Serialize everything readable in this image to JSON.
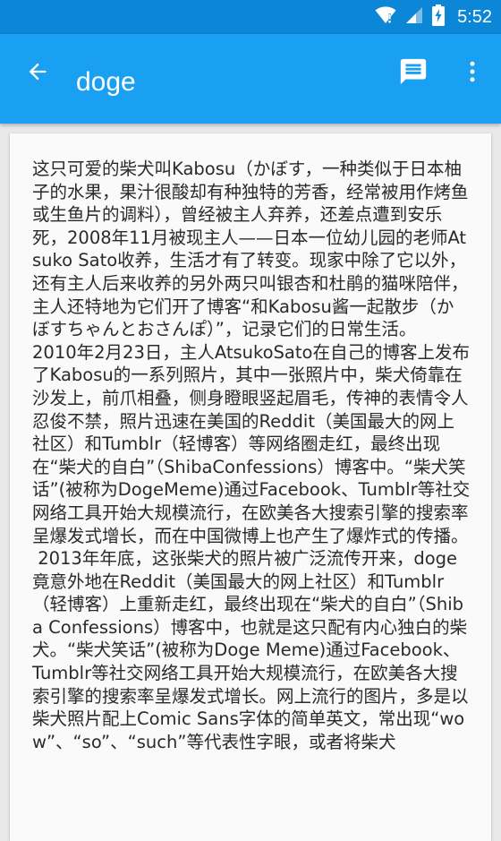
{
  "status_bar": {
    "time": "5:52",
    "icons": [
      "wifi-icon",
      "signal-icon",
      "battery-charging-icon"
    ]
  },
  "app_bar": {
    "title": "doge",
    "back_icon": "arrow-back-icon",
    "message_icon": "message-icon",
    "more_icon": "more-vert-icon"
  },
  "colors": {
    "status_bar": "#0c86d6",
    "app_bar": "#1aa0f2",
    "background": "#e9e9e9",
    "card": "#fafafa",
    "text": "#2a2a2a"
  },
  "article": {
    "text": "这只可爱的柴犬叫Kabosu（かぼす，一种类似于日本柚子的水果，果汁很酸却有种独特的芳香，经常被用作烤鱼或生鱼片的调料），曾经被主人弃养，还差点遭到安乐死，2008年11月被现主人——日本一位幼儿园的老师Atsuko Sato收养，生活才有了转变。现家中除了它以外，还有主人后来收养的另外两只叫银杏和杜鹃的猫咪陪伴，主人还特地为它们开了博客“和Kabosu酱一起散步（かぼすちゃんとおさんぽ）”，记录它们的日常生活。\n2010年2月23日，主人AtsukoSato在自己的博客上发布了Kabosu的一系列照片，其中一张照片中，柴犬倚靠在沙发上，前爪相叠，侧身瞪眼竖起眉毛，传神的表情令人忍俊不禁，照片迅速在美国的Reddit（美国最大的网上社区）和Tumblr（轻博客）等网络圈走红，最终出现在“柴犬的自白”（ShibaConfessions）博客中。“柴犬笑话”(被称为DogeMeme)通过Facebook、Tumblr等社交网络工具开始大规模流行，在欧美各大搜索引擎的搜索率呈爆发式增长，而在中国微博上也产生了爆炸式的传播。\n 2013年年底，这张柴犬的照片被广泛流传开来，doge竟意外地在Reddit（美国最大的网上社区）和Tumblr（轻博客）上重新走红，最终出现在“柴犬的自白”（Shiba Confessions）博客中，也就是这只配有内心独白的柴犬。“柴犬笑话”(被称为Doge Meme)通过Facebook、Tumblr等社交网络工具开始大规模流行，在欧美各大搜索引擎的搜索率呈爆发式增长。网上流行的图片，多是以柴犬照片配上Comic Sans字体的简单英文，常出现“wow”、“so”、“such”等代表性字眼，或者将柴犬"
  }
}
